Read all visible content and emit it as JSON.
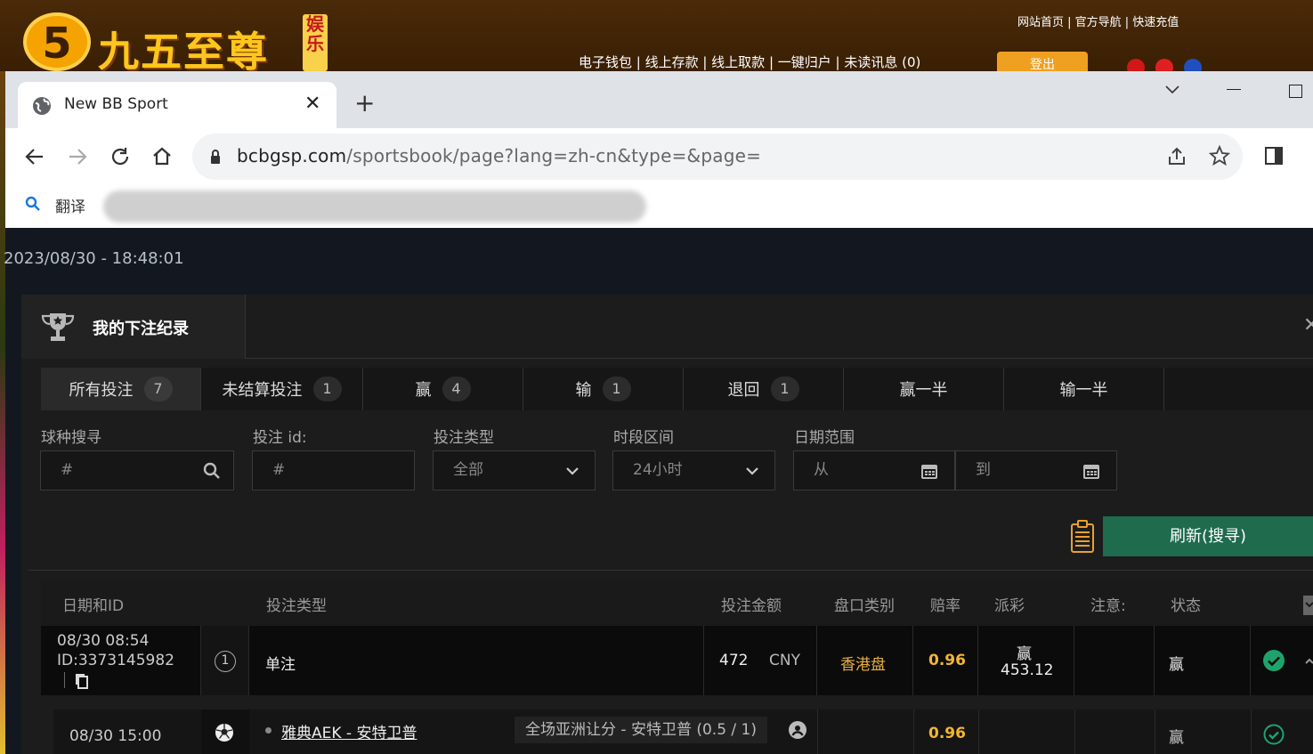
{
  "site": {
    "logo_glyph": "5",
    "brand": "九五至尊",
    "tag": "娱乐",
    "top_links": "网站首页 | 官方导航 | 快速充值",
    "mid_links": "电子钱包 | 线上存款 | 线上取款 | 一键归户 | 未读讯息 (0)",
    "logout": "登出"
  },
  "browser": {
    "tab_title": "New BB Sport",
    "tab_close": "✕",
    "new_tab": "+",
    "url_host": "bcbgsp.com",
    "url_path": "/sportsbook/page?lang=zh-cn&type=&page=",
    "bookmark_label": "翻译"
  },
  "page": {
    "clock": "2023/08/30 - 18:48:01",
    "modal_title": "我的下注纪录",
    "close_glyph": "✕",
    "tabs": [
      {
        "label": "所有投注",
        "count": "7"
      },
      {
        "label": "未结算投注",
        "count": "1"
      },
      {
        "label": "赢",
        "count": "4"
      },
      {
        "label": "输",
        "count": "1"
      },
      {
        "label": "退回",
        "count": "1"
      },
      {
        "label": "赢一半",
        "count": ""
      },
      {
        "label": "输一半",
        "count": ""
      }
    ],
    "filters": {
      "sport_label": "球种搜寻",
      "sport_placeholder": "#",
      "betid_label": "投注 id:",
      "betid_placeholder": "#",
      "type_label": "投注类型",
      "type_value": "全部",
      "period_label": "时段区间",
      "period_value": "24小时",
      "date_label": "日期范围",
      "date_from": "从",
      "date_to": "到"
    },
    "refresh": "刷新(搜寻)",
    "columns": [
      "日期和ID",
      "投注类型",
      "投注金额",
      "盘口类别",
      "赔率",
      "派彩",
      "注意:",
      "状态"
    ],
    "bet": {
      "date": "08/30 08:54",
      "id": "ID:3373145982",
      "number": "1",
      "type": "单注",
      "amount": "472",
      "currency": "CNY",
      "market": "香港盘",
      "odds": "0.96",
      "payout_label": "赢",
      "payout": "453.12",
      "status": "赢"
    },
    "selection": {
      "date": "08/30 15:00",
      "match": "雅典AEK - 安特卫普",
      "pick": "全场亚洲让分 - 安特卫普 (0.5 / 1)",
      "odds": "0.96",
      "status": "赢"
    }
  }
}
